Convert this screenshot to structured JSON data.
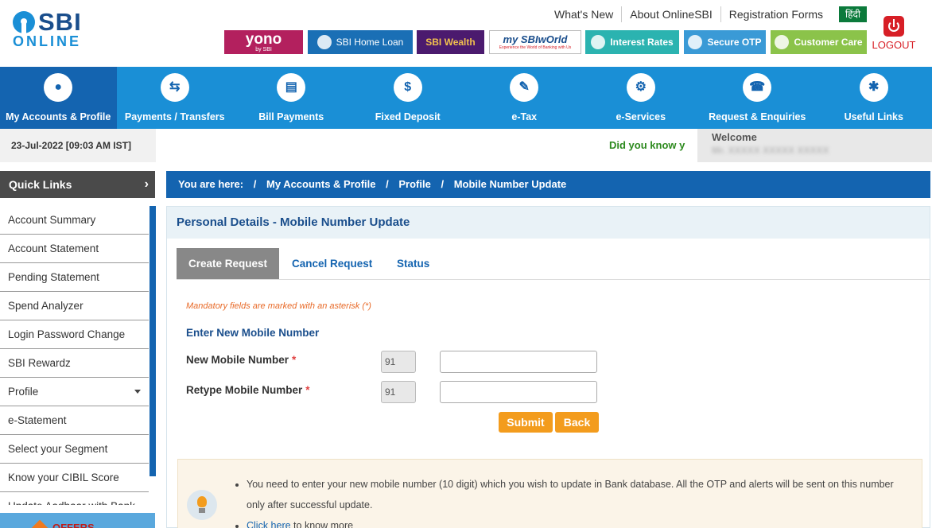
{
  "brand": {
    "sbi": "SBI",
    "online": "ONLINE"
  },
  "top_links": [
    "What's New",
    "About OnlineSBI",
    "Registration Forms"
  ],
  "hindi": "हिंदी",
  "promos": {
    "yono": "yono",
    "yono_sub": "by SBI",
    "home_loan": "SBI Home Loan",
    "wealth": "SBI Wealth",
    "my_sbi_world": "my SBIwOrld",
    "my_sbi_world_sub": "Experience the World of Banking with Us",
    "interest_rates": "Interest Rates",
    "secure_otp": "Secure OTP",
    "customer_care": "Customer Care"
  },
  "logout": "LOGOUT",
  "nav": [
    {
      "label": "My Accounts & Profile",
      "icon": "user-icon",
      "glyph": "●",
      "active": true
    },
    {
      "label": "Payments / Transfers",
      "icon": "transfer-icon",
      "glyph": "⇆"
    },
    {
      "label": "Bill Payments",
      "icon": "bill-icon",
      "glyph": "▤"
    },
    {
      "label": "Fixed Deposit",
      "icon": "deposit-icon",
      "glyph": "$"
    },
    {
      "label": "e-Tax",
      "icon": "tax-icon",
      "glyph": "✎"
    },
    {
      "label": "e-Services",
      "icon": "services-icon",
      "glyph": "⚙"
    },
    {
      "label": "Request & Enquiries",
      "icon": "phone-icon",
      "glyph": "☎"
    },
    {
      "label": "Useful Links",
      "icon": "links-icon",
      "glyph": "✱"
    }
  ],
  "date": "23-Jul-2022 [09:03 AM IST]",
  "did_you_know": "Did you know y",
  "welcome": {
    "label": "Welcome",
    "name": "Mr. XXXXX XXXXX XXXXX"
  },
  "quick_links": {
    "title": "Quick Links",
    "items": [
      {
        "label": "Account Summary"
      },
      {
        "label": "Account Statement"
      },
      {
        "label": "Pending Statement"
      },
      {
        "label": "Spend Analyzer"
      },
      {
        "label": "Login Password Change"
      },
      {
        "label": "SBI Rewardz"
      },
      {
        "label": "Profile",
        "dropdown": true
      },
      {
        "label": "e-Statement"
      },
      {
        "label": "Select your Segment"
      },
      {
        "label": "Know your CIBIL Score"
      },
      {
        "label": "Update Aadhaar with Bank"
      }
    ]
  },
  "offers": "OFFERS",
  "breadcrumb": {
    "prefix": "You are here:",
    "items": [
      "My Accounts & Profile",
      "Profile",
      "Mobile Number Update"
    ]
  },
  "panel": {
    "title": "Personal Details - Mobile Number Update",
    "tabs": [
      "Create Request",
      "Cancel Request",
      "Status"
    ],
    "mandatory_note": "Mandatory fields are marked with an asterisk (*)",
    "section_title": "Enter New Mobile Number",
    "fields": [
      {
        "label": "New Mobile Number",
        "prefix": "91",
        "value": ""
      },
      {
        "label": "Retype Mobile Number",
        "prefix": "91",
        "value": ""
      }
    ],
    "asterisk": "*",
    "submit": "Submit",
    "back": "Back"
  },
  "note": {
    "line1": "You need to enter your new mobile number (10 digit) which you wish to update in Bank database. All the OTP and alerts will be sent on this number only after successful update.",
    "click_here": "Click here",
    "line2_rest": " to know more"
  },
  "colors": {
    "primary_blue": "#1a8fd6",
    "dark_blue": "#1464b0",
    "orange": "#f39c1d",
    "green": "#2d8a1e",
    "red": "#d71f26"
  }
}
